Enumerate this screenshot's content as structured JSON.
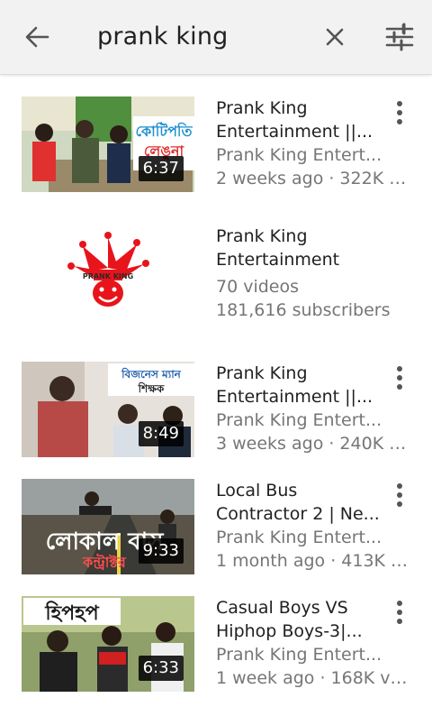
{
  "search": {
    "query": "prank king"
  },
  "results": [
    {
      "type": "video",
      "title_line1": "Prank King",
      "title_line2": "Entertainment ||...",
      "channel": "Prank King Entert...",
      "info": "2 weeks ago · 322K vi...",
      "duration": "6:37",
      "thumb_text": "কোটিপতি লেঙুনা"
    },
    {
      "type": "channel",
      "title_line1": "Prank King",
      "title_line2": "Entertainment",
      "videos": "70 videos",
      "subscribers": "181,616 subscribers",
      "logo_text": "PRANK KING"
    },
    {
      "type": "video",
      "title_line1": "Prank King",
      "title_line2": "Entertainment ||...",
      "channel": "Prank King Entert...",
      "info": "3 weeks ago · 240K v...",
      "duration": "8:49",
      "thumb_text": "বিজনেস ম্যান শিক্ষক"
    },
    {
      "type": "video",
      "title_line1": "Local Bus",
      "title_line2": "Contractor 2 | Ne...",
      "channel": "Prank King Entert...",
      "info": "1 month ago · 413K vi...",
      "duration": "9:33",
      "thumb_text": "লোকাল বাস কন্ট্রাক্টর"
    },
    {
      "type": "video",
      "title_line1": "Casual Boys VS",
      "title_line2": "Hiphop Boys-3|...",
      "channel": "Prank King Entert...",
      "info": "1 week ago · 168K vie...",
      "duration": "6:33",
      "thumb_text": "হিপহপ"
    }
  ],
  "colors": {
    "accent_red": "#e8141b",
    "topbar_bg": "#f2f2f2",
    "secondary_text": "#767676"
  },
  "icons": {
    "back": "arrow-left-icon",
    "clear": "close-icon",
    "filter": "tune-sliders-icon",
    "more": "more-vertical-icon"
  }
}
